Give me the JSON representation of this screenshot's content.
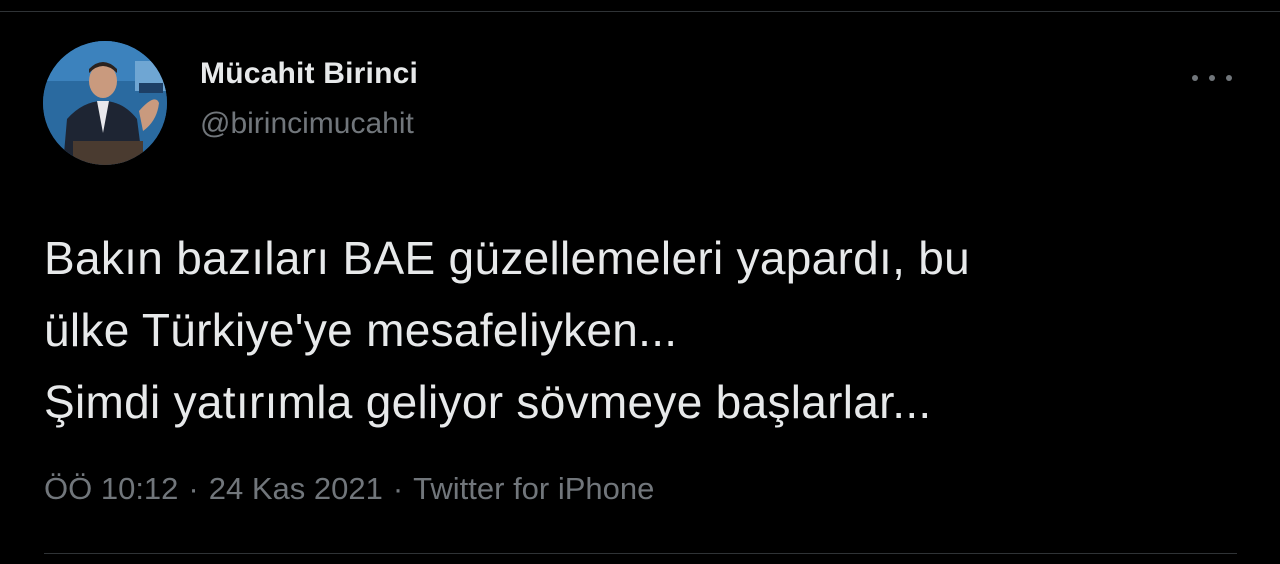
{
  "tweet": {
    "author": {
      "display_name": "Mücahit Birinci",
      "handle": "@birincimucahit",
      "avatar_icon": "profile-photo"
    },
    "more_icon": "more-horizontal-icon",
    "text_lines": [
      "Bakın bazıları BAE güzellemeleri yapardı, bu",
      "ülke Türkiye'ye mesafeliyken...",
      "Şimdi yatırımla geliyor sövmeye başlarlar..."
    ],
    "meta": {
      "time": "ÖÖ 10:12",
      "separator": "·",
      "date": "24 Kas 2021",
      "source": "Twitter for iPhone"
    }
  },
  "colors": {
    "background": "#000000",
    "primary_text": "#e7e9ea",
    "secondary_text": "#71767b",
    "divider": "#2f3336"
  }
}
